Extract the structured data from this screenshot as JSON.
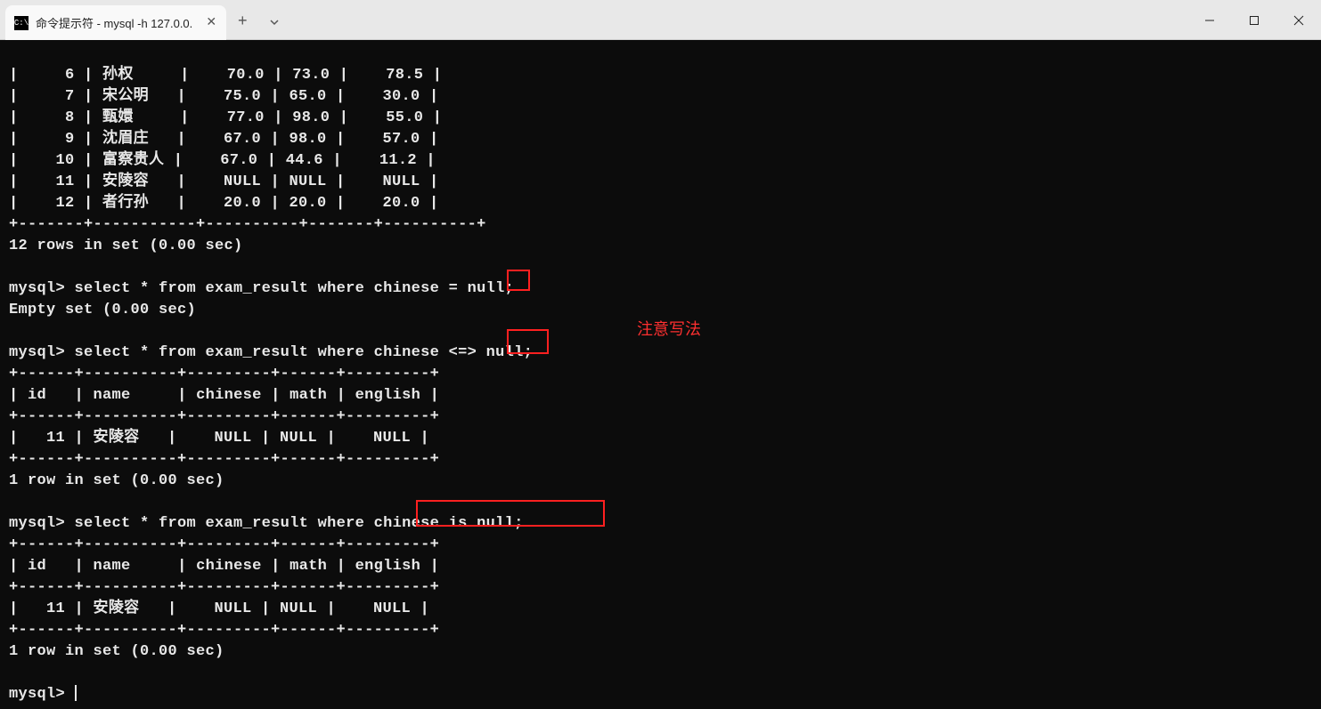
{
  "titlebar": {
    "tab_title": "命令提示符 - mysql  -h 127.0.0.",
    "tab_icon_label": "cmd-icon"
  },
  "terminal": {
    "rows": [
      {
        "id": "6",
        "name": "孙权",
        "chinese": "70.0",
        "math": "73.0",
        "english": "78.5"
      },
      {
        "id": "7",
        "name": "宋公明",
        "chinese": "75.0",
        "math": "65.0",
        "english": "30.0"
      },
      {
        "id": "8",
        "name": "甄嬛",
        "chinese": "77.0",
        "math": "98.0",
        "english": "55.0"
      },
      {
        "id": "9",
        "name": "沈眉庄",
        "chinese": "67.0",
        "math": "98.0",
        "english": "57.0"
      },
      {
        "id": "10",
        "name": "富察贵人",
        "chinese": "67.0",
        "math": "44.6",
        "english": "11.2"
      },
      {
        "id": "11",
        "name": "安陵容",
        "chinese": "NULL",
        "math": "NULL",
        "english": "NULL"
      },
      {
        "id": "12",
        "name": "者行孙",
        "chinese": "20.0",
        "math": "20.0",
        "english": "20.0"
      }
    ],
    "rows_footer": "12 rows in set (0.00 sec)",
    "prompt": "mysql>",
    "query1_pre": "select * from exam_result where chinese ",
    "query1_op": "=",
    "query1_post": " null;",
    "query1_result": "Empty set (0.00 sec)",
    "query2_pre": "select * from exam_result where chinese ",
    "query2_op": "<=>",
    "query2_post": " null;",
    "result_header": {
      "id": "id",
      "name": "name",
      "chinese": "chinese",
      "math": "math",
      "english": "english"
    },
    "result_row": {
      "id": "11",
      "name": "安陵容",
      "chinese": "NULL",
      "math": "NULL",
      "english": "NULL"
    },
    "one_row_footer": "1 row in set (0.00 sec)",
    "query3_pre": "select * from exam_result where ",
    "query3_boxed": "chinese is null;",
    "divider": "+------+----------+---------+------+---------+",
    "big_divider": "+-------+-----------+----------+-------+----------+"
  },
  "annotation": {
    "text": "注意写法"
  }
}
